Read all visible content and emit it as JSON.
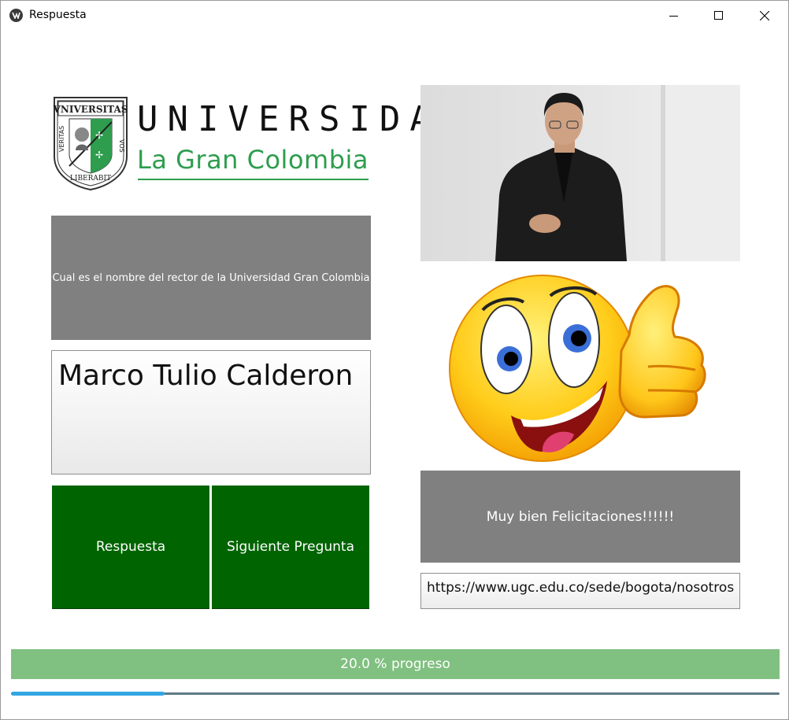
{
  "window": {
    "title": "Respuesta",
    "icon": "kivy-app-icon",
    "controls": [
      "minimize-icon",
      "maximize-icon",
      "close-icon"
    ]
  },
  "logo": {
    "line1": "UNIVERSIDAD",
    "line2": "La Gran Colombia",
    "crest_top": "VNIVERSITAS",
    "crest_left": "VERITAS",
    "crest_right": "VOS",
    "crest_bottom": "LIBERABIT",
    "colors": {
      "green": "#2e9d4e",
      "text": "#111111"
    }
  },
  "question": {
    "text": "Cual es el nombre del rector de la Universidad Gran Colombia"
  },
  "answer": {
    "value": "Marco Tulio Calderon"
  },
  "buttons": {
    "respuesta": "Respuesta",
    "siguiente": "Siguiente Pregunta"
  },
  "feedback": {
    "text": "Muy bien Felicitaciones!!!!!!"
  },
  "url": {
    "value": "https://www.ugc.edu.co/sede/bogota/nosotros"
  },
  "progress": {
    "label": "20.0 % progreso",
    "fraction": 0.2
  },
  "colors": {
    "button_green": "#006400",
    "panel_gray": "#808080",
    "progress_label_bg": "#80c080",
    "progress_fill": "#33a6e3"
  }
}
